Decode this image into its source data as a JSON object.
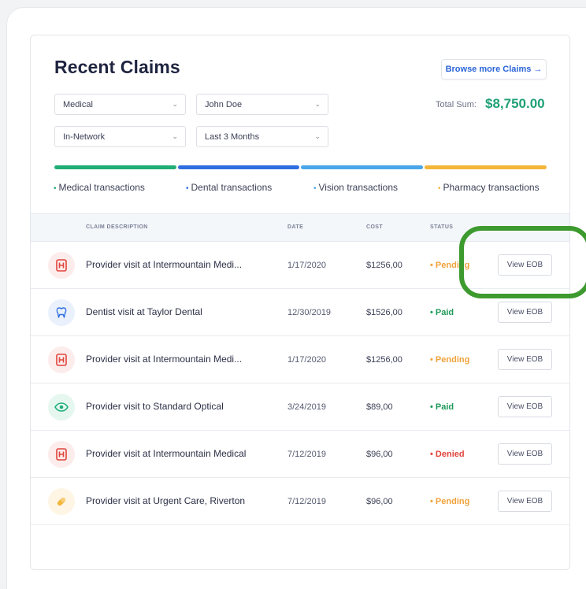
{
  "title": "Recent Claims",
  "browse_button": "Browse more Claims →",
  "filters": {
    "type": "Medical",
    "member": "John Doe",
    "network": "In-Network",
    "period": "Last 3 Months"
  },
  "total": {
    "label": "Total Sum:",
    "value": "$8,750.00"
  },
  "colors": {
    "medical": "#1fae78",
    "dental": "#2f6ee0",
    "vision": "#4aa6e8",
    "pharmacy": "#f3b63a",
    "paid": "#1f9a5a",
    "pending": "#f0a23a",
    "denied": "#e0453c"
  },
  "legend": [
    {
      "label": "Medical transactions",
      "color": "#1fae78"
    },
    {
      "label": "Dental transactions",
      "color": "#2f6ee0"
    },
    {
      "label": "Vision transactions",
      "color": "#4aa6e8"
    },
    {
      "label": "Pharmacy transactions",
      "color": "#f3b63a"
    }
  ],
  "columns": {
    "description": "CLAIM DESCRIPTION",
    "date": "DATE",
    "cost": "COST",
    "status": "STATUS"
  },
  "rows": [
    {
      "icon": "hospital-icon",
      "description": "Provider visit at Intermountain Medi...",
      "date": "1/17/2020",
      "cost": "$1256,00",
      "status": "Pending",
      "action": "View EOB"
    },
    {
      "icon": "tooth-icon",
      "description": "Dentist visit at Taylor Dental",
      "date": "12/30/2019",
      "cost": "$1526,00",
      "status": "Paid",
      "action": "View EOB"
    },
    {
      "icon": "hospital-icon",
      "description": "Provider visit at Intermountain Medi...",
      "date": "1/17/2020",
      "cost": "$1256,00",
      "status": "Pending",
      "action": "View EOB"
    },
    {
      "icon": "eye-icon",
      "description": "Provider visit to Standard Optical",
      "date": "3/24/2019",
      "cost": "$89,00",
      "status": "Paid",
      "action": "View EOB"
    },
    {
      "icon": "hospital-icon",
      "description": "Provider visit at Intermountain Medical",
      "date": "7/12/2019",
      "cost": "$96,00",
      "status": "Denied",
      "action": "View EOB"
    },
    {
      "icon": "pill-icon",
      "description": "Provider visit at Urgent Care, Riverton",
      "date": "7/12/2019",
      "cost": "$96,00",
      "status": "Pending",
      "action": "View EOB"
    }
  ]
}
